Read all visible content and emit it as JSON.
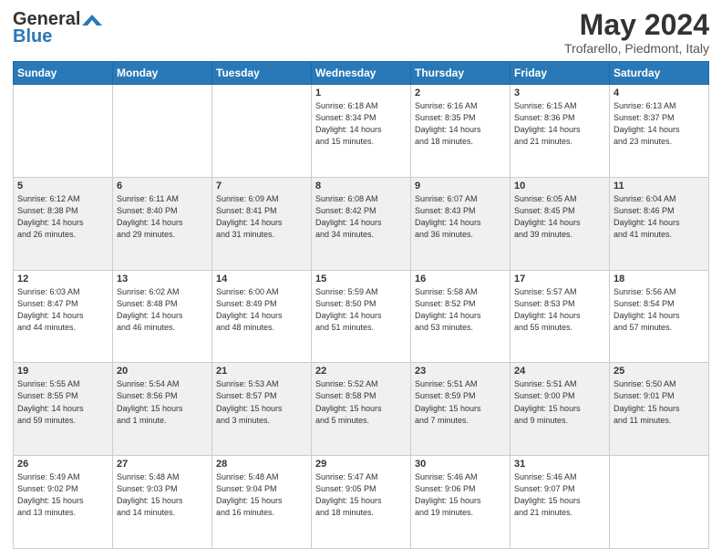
{
  "header": {
    "logo_line1": "General",
    "logo_line2": "Blue",
    "month": "May 2024",
    "location": "Trofarello, Piedmont, Italy"
  },
  "days_of_week": [
    "Sunday",
    "Monday",
    "Tuesday",
    "Wednesday",
    "Thursday",
    "Friday",
    "Saturday"
  ],
  "weeks": [
    [
      {
        "day": "",
        "info": ""
      },
      {
        "day": "",
        "info": ""
      },
      {
        "day": "",
        "info": ""
      },
      {
        "day": "1",
        "info": "Sunrise: 6:18 AM\nSunset: 8:34 PM\nDaylight: 14 hours\nand 15 minutes."
      },
      {
        "day": "2",
        "info": "Sunrise: 6:16 AM\nSunset: 8:35 PM\nDaylight: 14 hours\nand 18 minutes."
      },
      {
        "day": "3",
        "info": "Sunrise: 6:15 AM\nSunset: 8:36 PM\nDaylight: 14 hours\nand 21 minutes."
      },
      {
        "day": "4",
        "info": "Sunrise: 6:13 AM\nSunset: 8:37 PM\nDaylight: 14 hours\nand 23 minutes."
      }
    ],
    [
      {
        "day": "5",
        "info": "Sunrise: 6:12 AM\nSunset: 8:38 PM\nDaylight: 14 hours\nand 26 minutes."
      },
      {
        "day": "6",
        "info": "Sunrise: 6:11 AM\nSunset: 8:40 PM\nDaylight: 14 hours\nand 29 minutes."
      },
      {
        "day": "7",
        "info": "Sunrise: 6:09 AM\nSunset: 8:41 PM\nDaylight: 14 hours\nand 31 minutes."
      },
      {
        "day": "8",
        "info": "Sunrise: 6:08 AM\nSunset: 8:42 PM\nDaylight: 14 hours\nand 34 minutes."
      },
      {
        "day": "9",
        "info": "Sunrise: 6:07 AM\nSunset: 8:43 PM\nDaylight: 14 hours\nand 36 minutes."
      },
      {
        "day": "10",
        "info": "Sunrise: 6:05 AM\nSunset: 8:45 PM\nDaylight: 14 hours\nand 39 minutes."
      },
      {
        "day": "11",
        "info": "Sunrise: 6:04 AM\nSunset: 8:46 PM\nDaylight: 14 hours\nand 41 minutes."
      }
    ],
    [
      {
        "day": "12",
        "info": "Sunrise: 6:03 AM\nSunset: 8:47 PM\nDaylight: 14 hours\nand 44 minutes."
      },
      {
        "day": "13",
        "info": "Sunrise: 6:02 AM\nSunset: 8:48 PM\nDaylight: 14 hours\nand 46 minutes."
      },
      {
        "day": "14",
        "info": "Sunrise: 6:00 AM\nSunset: 8:49 PM\nDaylight: 14 hours\nand 48 minutes."
      },
      {
        "day": "15",
        "info": "Sunrise: 5:59 AM\nSunset: 8:50 PM\nDaylight: 14 hours\nand 51 minutes."
      },
      {
        "day": "16",
        "info": "Sunrise: 5:58 AM\nSunset: 8:52 PM\nDaylight: 14 hours\nand 53 minutes."
      },
      {
        "day": "17",
        "info": "Sunrise: 5:57 AM\nSunset: 8:53 PM\nDaylight: 14 hours\nand 55 minutes."
      },
      {
        "day": "18",
        "info": "Sunrise: 5:56 AM\nSunset: 8:54 PM\nDaylight: 14 hours\nand 57 minutes."
      }
    ],
    [
      {
        "day": "19",
        "info": "Sunrise: 5:55 AM\nSunset: 8:55 PM\nDaylight: 14 hours\nand 59 minutes."
      },
      {
        "day": "20",
        "info": "Sunrise: 5:54 AM\nSunset: 8:56 PM\nDaylight: 15 hours\nand 1 minute."
      },
      {
        "day": "21",
        "info": "Sunrise: 5:53 AM\nSunset: 8:57 PM\nDaylight: 15 hours\nand 3 minutes."
      },
      {
        "day": "22",
        "info": "Sunrise: 5:52 AM\nSunset: 8:58 PM\nDaylight: 15 hours\nand 5 minutes."
      },
      {
        "day": "23",
        "info": "Sunrise: 5:51 AM\nSunset: 8:59 PM\nDaylight: 15 hours\nand 7 minutes."
      },
      {
        "day": "24",
        "info": "Sunrise: 5:51 AM\nSunset: 9:00 PM\nDaylight: 15 hours\nand 9 minutes."
      },
      {
        "day": "25",
        "info": "Sunrise: 5:50 AM\nSunset: 9:01 PM\nDaylight: 15 hours\nand 11 minutes."
      }
    ],
    [
      {
        "day": "26",
        "info": "Sunrise: 5:49 AM\nSunset: 9:02 PM\nDaylight: 15 hours\nand 13 minutes."
      },
      {
        "day": "27",
        "info": "Sunrise: 5:48 AM\nSunset: 9:03 PM\nDaylight: 15 hours\nand 14 minutes."
      },
      {
        "day": "28",
        "info": "Sunrise: 5:48 AM\nSunset: 9:04 PM\nDaylight: 15 hours\nand 16 minutes."
      },
      {
        "day": "29",
        "info": "Sunrise: 5:47 AM\nSunset: 9:05 PM\nDaylight: 15 hours\nand 18 minutes."
      },
      {
        "day": "30",
        "info": "Sunrise: 5:46 AM\nSunset: 9:06 PM\nDaylight: 15 hours\nand 19 minutes."
      },
      {
        "day": "31",
        "info": "Sunrise: 5:46 AM\nSunset: 9:07 PM\nDaylight: 15 hours\nand 21 minutes."
      },
      {
        "day": "",
        "info": ""
      }
    ]
  ]
}
